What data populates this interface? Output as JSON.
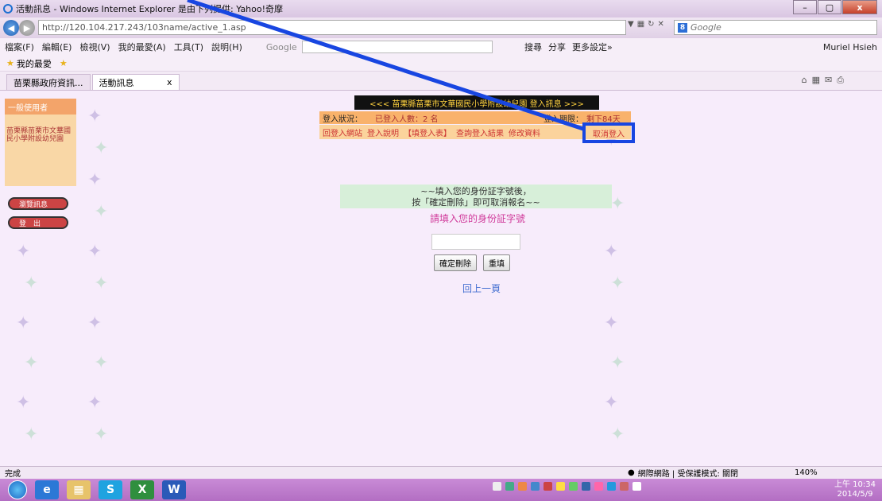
{
  "window": {
    "title": "活動訊息 - Windows Internet Explorer 是由下列提供: Yahoo!奇摩"
  },
  "address": {
    "url": "http://120.104.217.243/103name/active_1.asp",
    "search_placeholder": "Google"
  },
  "menu": {
    "items": [
      "檔案(F)",
      "編輯(E)",
      "檢視(V)",
      "我的最愛(A)",
      "工具(T)",
      "說明(H)"
    ],
    "google_toolbar": "Google",
    "right_items": [
      "搜尋",
      "分享",
      "更多設定»"
    ],
    "user": "Muriel Hsieh"
  },
  "favorites": {
    "label": "我的最愛"
  },
  "tabs": [
    {
      "label": "苗栗縣政府資訊..."
    },
    {
      "label": "活動訊息"
    }
  ],
  "sidebar": {
    "header": "一般使用者",
    "org_name": "苗栗縣苗栗市文華國民小學附設幼兒園",
    "buttons": [
      "瀏覽訊息",
      "登　出"
    ]
  },
  "banner": {
    "text": "<<< 苗栗縣苗栗市文華國民小學附設幼兒園 登入訊息 >>>"
  },
  "status": {
    "label": "登入狀況：",
    "count": "已登入人數：2 名",
    "deadline_label": "登入期限：",
    "remaining": "剩下84天"
  },
  "links": [
    "回登入網站",
    "登入說明",
    "【填登入表】",
    "查詢登入結果",
    "修改資料",
    "取消登入"
  ],
  "info": {
    "line1": "~~填入您的身份証字號後，",
    "line2": "按「確定刪除」即可取消報名~~"
  },
  "prompt": "請填入您的身份証字號",
  "form": {
    "confirm_button": "確定刪除",
    "reset_button": "重填"
  },
  "back_link": "回上一頁",
  "statusbar": {
    "text": "完成",
    "zone": "網際網路 | 受保護模式: 關閉",
    "zoom": "140%"
  },
  "clock": {
    "time": "上午 10:34",
    "date": "2014/5/9"
  },
  "colors": {
    "highlight": "#1846e1",
    "banner_bg": "#111111",
    "status_bg": "#f9b26b"
  }
}
